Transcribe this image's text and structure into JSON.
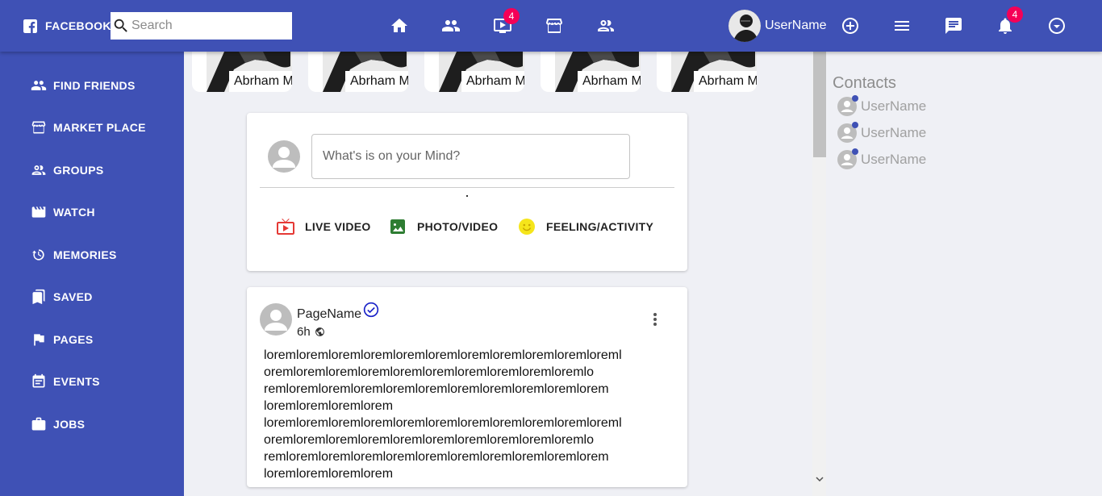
{
  "colors": {
    "appbar": "#3f51b5",
    "drawer": "#3f51b5",
    "badge": "#f50057",
    "page_background": "#eff0f5",
    "live_video_icon": "#e53935",
    "photo_icon": "#2e7d32",
    "feeling_icon": "#f5e51b",
    "verified_icon": "#1a22c8"
  },
  "header": {
    "brand": "FACEBOOK",
    "brand_icon": "facebook-icon",
    "search_placeholder": "Search",
    "nav": [
      {
        "name": "home-icon"
      },
      {
        "name": "friends-icon"
      },
      {
        "name": "watch-icon",
        "badge": "4"
      },
      {
        "name": "marketplace-icon"
      },
      {
        "name": "groups-icon"
      }
    ],
    "user_name": "UserName",
    "actions": [
      {
        "name": "add-circle-icon"
      },
      {
        "name": "menu-icon"
      },
      {
        "name": "messenger-icon"
      },
      {
        "name": "notifications-icon",
        "badge": "4"
      },
      {
        "name": "account-dropdown-icon"
      }
    ]
  },
  "sidebar": {
    "items": [
      {
        "label": "FIND FRIENDS",
        "icon": "people-icon"
      },
      {
        "label": "MARKET PLACE",
        "icon": "store-icon"
      },
      {
        "label": "GROUPS",
        "icon": "groups-icon"
      },
      {
        "label": "WATCH",
        "icon": "movie-icon"
      },
      {
        "label": "MEMORIES",
        "icon": "history-icon"
      },
      {
        "label": "SAVED",
        "icon": "bookmarks-icon"
      },
      {
        "label": "PAGES",
        "icon": "flag-icon"
      },
      {
        "label": "EVENTS",
        "icon": "event-icon"
      },
      {
        "label": "JOBS",
        "icon": "work-icon"
      }
    ]
  },
  "stories": [
    {
      "name": "Abrham M"
    },
    {
      "name": "Abrham M"
    },
    {
      "name": "Abrham M"
    },
    {
      "name": "Abrham M"
    },
    {
      "name": "Abrham M"
    }
  ],
  "composer": {
    "placeholder": "What's is on your Mind?",
    "actions": [
      {
        "label": "LIVE VIDEO",
        "icon": "live-tv-icon"
      },
      {
        "label": "PHOTO/VIDEO",
        "icon": "photo-icon"
      },
      {
        "label": "FEELING/ACTIVITY",
        "icon": "emoji-icon"
      }
    ]
  },
  "post": {
    "page_name": "PageName",
    "time": "6h",
    "verified_icon": "verified-check-icon",
    "privacy_icon": "globe-icon",
    "body_lines": [
      "loremloremloremloremloremloremloremloremloremloremloreml",
      "oremloremloremloremloremloremloremloremloremloremlo",
      "remloremloremloremloremloremloremloremloremloremlorem",
      "loremloremloremlorem",
      "loremloremloremloremloremloremloremloremloremloremloreml",
      "oremloremloremloremloremloremloremloremloremloremlo",
      "remloremloremloremloremloremloremloremloremloremlorem",
      "loremloremloremlorem"
    ]
  },
  "contacts": {
    "title": "Contacts",
    "items": [
      {
        "name": "UserName",
        "online": true
      },
      {
        "name": "UserName",
        "online": true
      },
      {
        "name": "UserName",
        "online": true
      }
    ]
  }
}
